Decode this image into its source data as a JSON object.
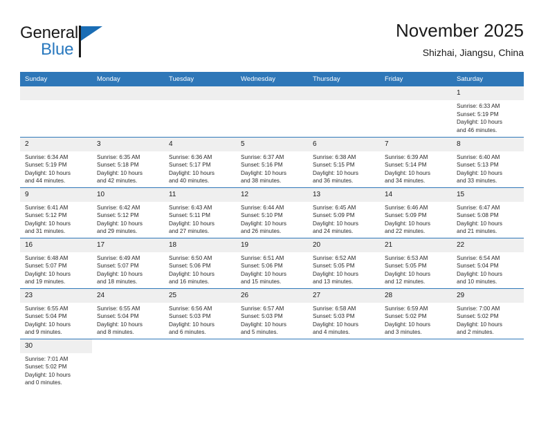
{
  "brand": {
    "name_line1": "General",
    "name_line2": "Blue",
    "accent_color": "#2878be",
    "flag_color": "#1a6db5"
  },
  "header": {
    "title": "November 2025",
    "subtitle": "Shizhai, Jiangsu, China",
    "header_bg": "#2e77b8",
    "daynum_bg": "#efefef"
  },
  "weekdays": [
    "Sunday",
    "Monday",
    "Tuesday",
    "Wednesday",
    "Thursday",
    "Friday",
    "Saturday"
  ],
  "labels": {
    "sunrise": "Sunrise:",
    "sunset": "Sunset:",
    "daylight": "Daylight:"
  },
  "weeks": [
    [
      {
        "empty": true
      },
      {
        "empty": true
      },
      {
        "empty": true
      },
      {
        "empty": true
      },
      {
        "empty": true
      },
      {
        "empty": true
      },
      {
        "day": "1",
        "sunrise": "Sunrise: 6:33 AM",
        "sunset": "Sunset: 5:19 PM",
        "daylight1": "Daylight: 10 hours",
        "daylight2": "and 46 minutes."
      }
    ],
    [
      {
        "day": "2",
        "sunrise": "Sunrise: 6:34 AM",
        "sunset": "Sunset: 5:19 PM",
        "daylight1": "Daylight: 10 hours",
        "daylight2": "and 44 minutes."
      },
      {
        "day": "3",
        "sunrise": "Sunrise: 6:35 AM",
        "sunset": "Sunset: 5:18 PM",
        "daylight1": "Daylight: 10 hours",
        "daylight2": "and 42 minutes."
      },
      {
        "day": "4",
        "sunrise": "Sunrise: 6:36 AM",
        "sunset": "Sunset: 5:17 PM",
        "daylight1": "Daylight: 10 hours",
        "daylight2": "and 40 minutes."
      },
      {
        "day": "5",
        "sunrise": "Sunrise: 6:37 AM",
        "sunset": "Sunset: 5:16 PM",
        "daylight1": "Daylight: 10 hours",
        "daylight2": "and 38 minutes."
      },
      {
        "day": "6",
        "sunrise": "Sunrise: 6:38 AM",
        "sunset": "Sunset: 5:15 PM",
        "daylight1": "Daylight: 10 hours",
        "daylight2": "and 36 minutes."
      },
      {
        "day": "7",
        "sunrise": "Sunrise: 6:39 AM",
        "sunset": "Sunset: 5:14 PM",
        "daylight1": "Daylight: 10 hours",
        "daylight2": "and 34 minutes."
      },
      {
        "day": "8",
        "sunrise": "Sunrise: 6:40 AM",
        "sunset": "Sunset: 5:13 PM",
        "daylight1": "Daylight: 10 hours",
        "daylight2": "and 33 minutes."
      }
    ],
    [
      {
        "day": "9",
        "sunrise": "Sunrise: 6:41 AM",
        "sunset": "Sunset: 5:12 PM",
        "daylight1": "Daylight: 10 hours",
        "daylight2": "and 31 minutes."
      },
      {
        "day": "10",
        "sunrise": "Sunrise: 6:42 AM",
        "sunset": "Sunset: 5:12 PM",
        "daylight1": "Daylight: 10 hours",
        "daylight2": "and 29 minutes."
      },
      {
        "day": "11",
        "sunrise": "Sunrise: 6:43 AM",
        "sunset": "Sunset: 5:11 PM",
        "daylight1": "Daylight: 10 hours",
        "daylight2": "and 27 minutes."
      },
      {
        "day": "12",
        "sunrise": "Sunrise: 6:44 AM",
        "sunset": "Sunset: 5:10 PM",
        "daylight1": "Daylight: 10 hours",
        "daylight2": "and 26 minutes."
      },
      {
        "day": "13",
        "sunrise": "Sunrise: 6:45 AM",
        "sunset": "Sunset: 5:09 PM",
        "daylight1": "Daylight: 10 hours",
        "daylight2": "and 24 minutes."
      },
      {
        "day": "14",
        "sunrise": "Sunrise: 6:46 AM",
        "sunset": "Sunset: 5:09 PM",
        "daylight1": "Daylight: 10 hours",
        "daylight2": "and 22 minutes."
      },
      {
        "day": "15",
        "sunrise": "Sunrise: 6:47 AM",
        "sunset": "Sunset: 5:08 PM",
        "daylight1": "Daylight: 10 hours",
        "daylight2": "and 21 minutes."
      }
    ],
    [
      {
        "day": "16",
        "sunrise": "Sunrise: 6:48 AM",
        "sunset": "Sunset: 5:07 PM",
        "daylight1": "Daylight: 10 hours",
        "daylight2": "and 19 minutes."
      },
      {
        "day": "17",
        "sunrise": "Sunrise: 6:49 AM",
        "sunset": "Sunset: 5:07 PM",
        "daylight1": "Daylight: 10 hours",
        "daylight2": "and 18 minutes."
      },
      {
        "day": "18",
        "sunrise": "Sunrise: 6:50 AM",
        "sunset": "Sunset: 5:06 PM",
        "daylight1": "Daylight: 10 hours",
        "daylight2": "and 16 minutes."
      },
      {
        "day": "19",
        "sunrise": "Sunrise: 6:51 AM",
        "sunset": "Sunset: 5:06 PM",
        "daylight1": "Daylight: 10 hours",
        "daylight2": "and 15 minutes."
      },
      {
        "day": "20",
        "sunrise": "Sunrise: 6:52 AM",
        "sunset": "Sunset: 5:05 PM",
        "daylight1": "Daylight: 10 hours",
        "daylight2": "and 13 minutes."
      },
      {
        "day": "21",
        "sunrise": "Sunrise: 6:53 AM",
        "sunset": "Sunset: 5:05 PM",
        "daylight1": "Daylight: 10 hours",
        "daylight2": "and 12 minutes."
      },
      {
        "day": "22",
        "sunrise": "Sunrise: 6:54 AM",
        "sunset": "Sunset: 5:04 PM",
        "daylight1": "Daylight: 10 hours",
        "daylight2": "and 10 minutes."
      }
    ],
    [
      {
        "day": "23",
        "sunrise": "Sunrise: 6:55 AM",
        "sunset": "Sunset: 5:04 PM",
        "daylight1": "Daylight: 10 hours",
        "daylight2": "and 9 minutes."
      },
      {
        "day": "24",
        "sunrise": "Sunrise: 6:55 AM",
        "sunset": "Sunset: 5:04 PM",
        "daylight1": "Daylight: 10 hours",
        "daylight2": "and 8 minutes."
      },
      {
        "day": "25",
        "sunrise": "Sunrise: 6:56 AM",
        "sunset": "Sunset: 5:03 PM",
        "daylight1": "Daylight: 10 hours",
        "daylight2": "and 6 minutes."
      },
      {
        "day": "26",
        "sunrise": "Sunrise: 6:57 AM",
        "sunset": "Sunset: 5:03 PM",
        "daylight1": "Daylight: 10 hours",
        "daylight2": "and 5 minutes."
      },
      {
        "day": "27",
        "sunrise": "Sunrise: 6:58 AM",
        "sunset": "Sunset: 5:03 PM",
        "daylight1": "Daylight: 10 hours",
        "daylight2": "and 4 minutes."
      },
      {
        "day": "28",
        "sunrise": "Sunrise: 6:59 AM",
        "sunset": "Sunset: 5:02 PM",
        "daylight1": "Daylight: 10 hours",
        "daylight2": "and 3 minutes."
      },
      {
        "day": "29",
        "sunrise": "Sunrise: 7:00 AM",
        "sunset": "Sunset: 5:02 PM",
        "daylight1": "Daylight: 10 hours",
        "daylight2": "and 2 minutes."
      }
    ],
    [
      {
        "day": "30",
        "sunrise": "Sunrise: 7:01 AM",
        "sunset": "Sunset: 5:02 PM",
        "daylight1": "Daylight: 10 hours",
        "daylight2": "and 0 minutes."
      },
      {
        "blank": true
      },
      {
        "blank": true
      },
      {
        "blank": true
      },
      {
        "blank": true
      },
      {
        "blank": true
      },
      {
        "blank": true
      }
    ]
  ]
}
